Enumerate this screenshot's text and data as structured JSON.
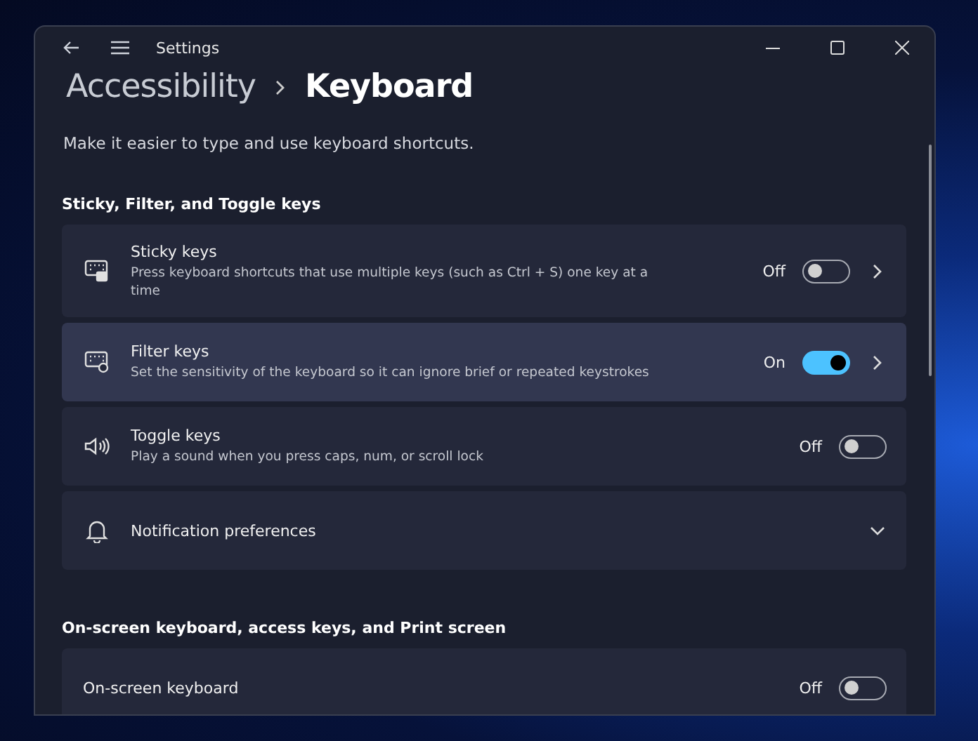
{
  "window": {
    "title": "Settings"
  },
  "breadcrumb": {
    "parent": "Accessibility",
    "current": "Keyboard"
  },
  "description": "Make it easier to type and use keyboard shortcuts.",
  "sections": [
    {
      "heading": "Sticky, Filter, and Toggle keys",
      "items": [
        {
          "kind": "toggle-link",
          "title": "Sticky keys",
          "subtitle": "Press keyboard shortcuts that use multiple keys (such as Ctrl + S) one key at a time",
          "state_label": "Off",
          "on": false,
          "hovered": false
        },
        {
          "kind": "toggle-link",
          "title": "Filter keys",
          "subtitle": "Set the sensitivity of the keyboard so it can ignore brief or repeated keystrokes",
          "state_label": "On",
          "on": true,
          "hovered": true
        },
        {
          "kind": "toggle",
          "title": "Toggle keys",
          "subtitle": "Play a sound when you press caps, num, or scroll lock",
          "state_label": "Off",
          "on": false,
          "hovered": false
        },
        {
          "kind": "expander",
          "title": "Notification preferences",
          "expanded": false,
          "hovered": false
        }
      ]
    },
    {
      "heading": "On-screen keyboard, access keys, and Print screen",
      "items": [
        {
          "kind": "toggle-plain",
          "title": "On-screen keyboard",
          "state_label": "Off",
          "on": false,
          "hovered": false
        }
      ]
    }
  ]
}
